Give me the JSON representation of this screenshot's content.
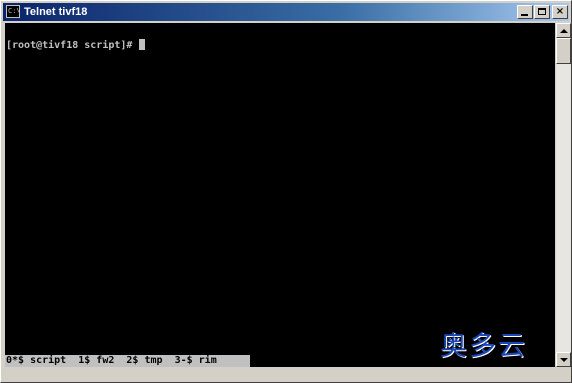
{
  "window": {
    "title": "Telnet tivf18",
    "icon_text": "C:\\",
    "controls": {
      "minimize": "minimize",
      "maximize": "maximize",
      "close": "×"
    }
  },
  "terminal": {
    "prompt": "[root@tivf18 script]# ",
    "status_line": "0*$ script  1$ fw2  2$ tmp  3-$ rim",
    "colors": {
      "background": "#000000",
      "foreground": "#c0c0c0",
      "status_bg": "#c0c0c0"
    }
  },
  "watermark": {
    "text": "奥多云",
    "color": "#1a47b8"
  }
}
